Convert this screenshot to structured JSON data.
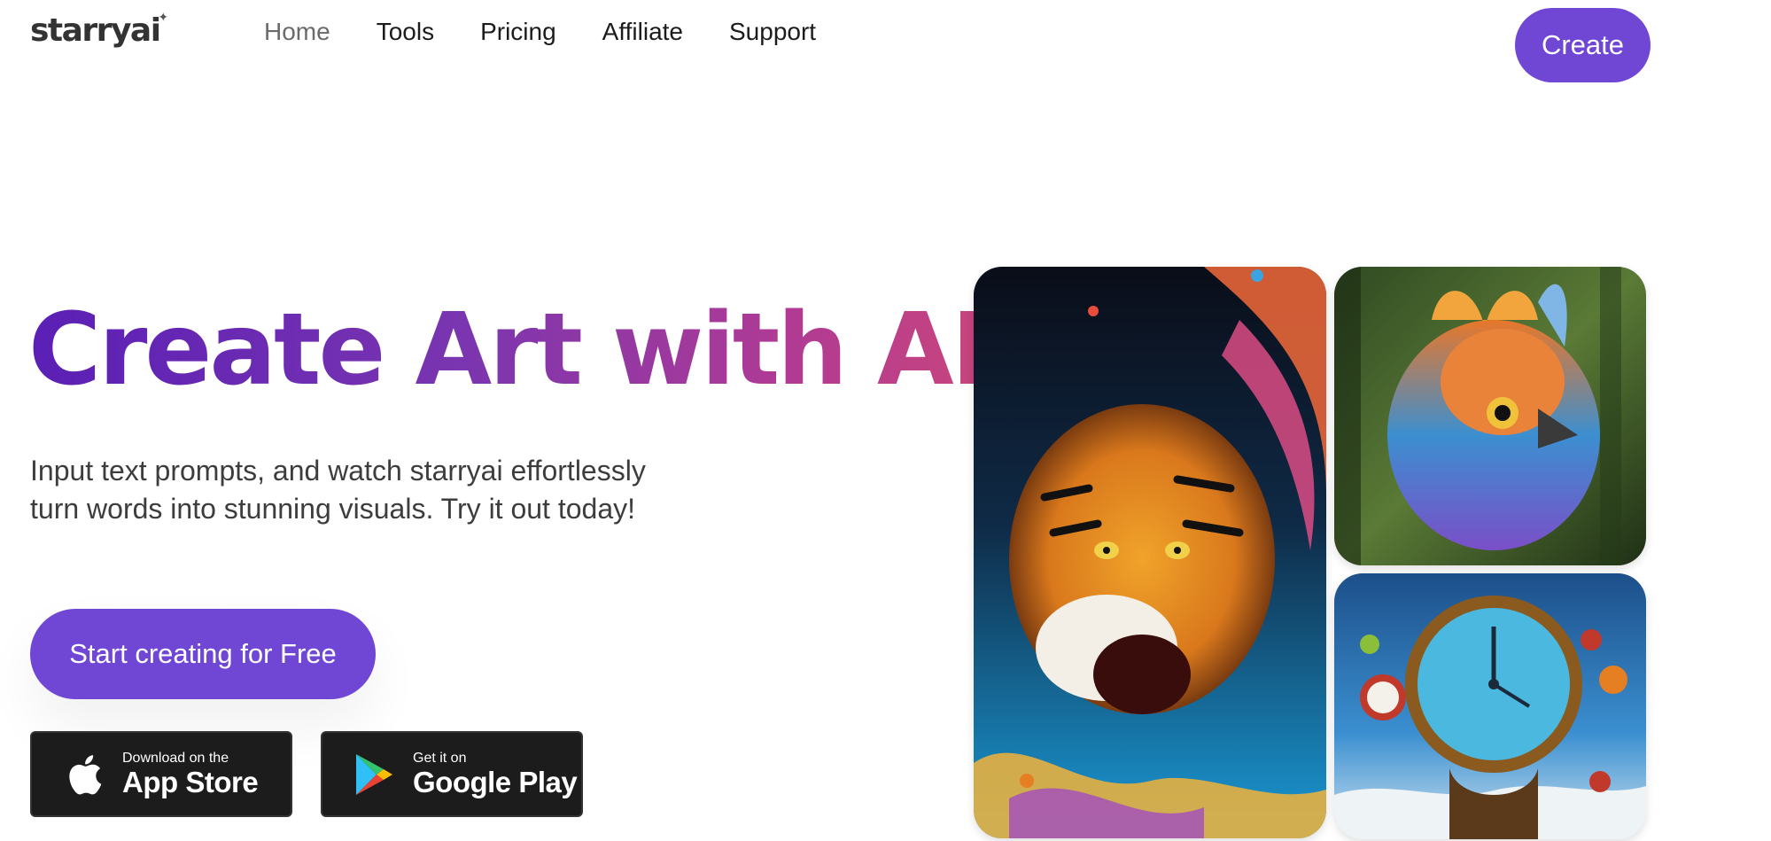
{
  "header": {
    "logo": "starryai",
    "nav": [
      "Home",
      "Tools",
      "Pricing",
      "Affiliate",
      "Support"
    ],
    "create_label": "Create"
  },
  "hero": {
    "title": "Create Art with AI",
    "subtitle_line1": "Input text prompts, and watch starryai effortlessly",
    "subtitle_line2": "turn words into stunning visuals. Try it out today!",
    "cta_label": "Start creating for Free"
  },
  "stores": {
    "apple": {
      "small": "Download on the",
      "big": "App Store"
    },
    "google": {
      "small": "Get it on",
      "big": "Google Play"
    }
  },
  "colors": {
    "accent": "#7046d4",
    "gradient_start": "#5a1fb5",
    "gradient_end": "#c8457d"
  }
}
